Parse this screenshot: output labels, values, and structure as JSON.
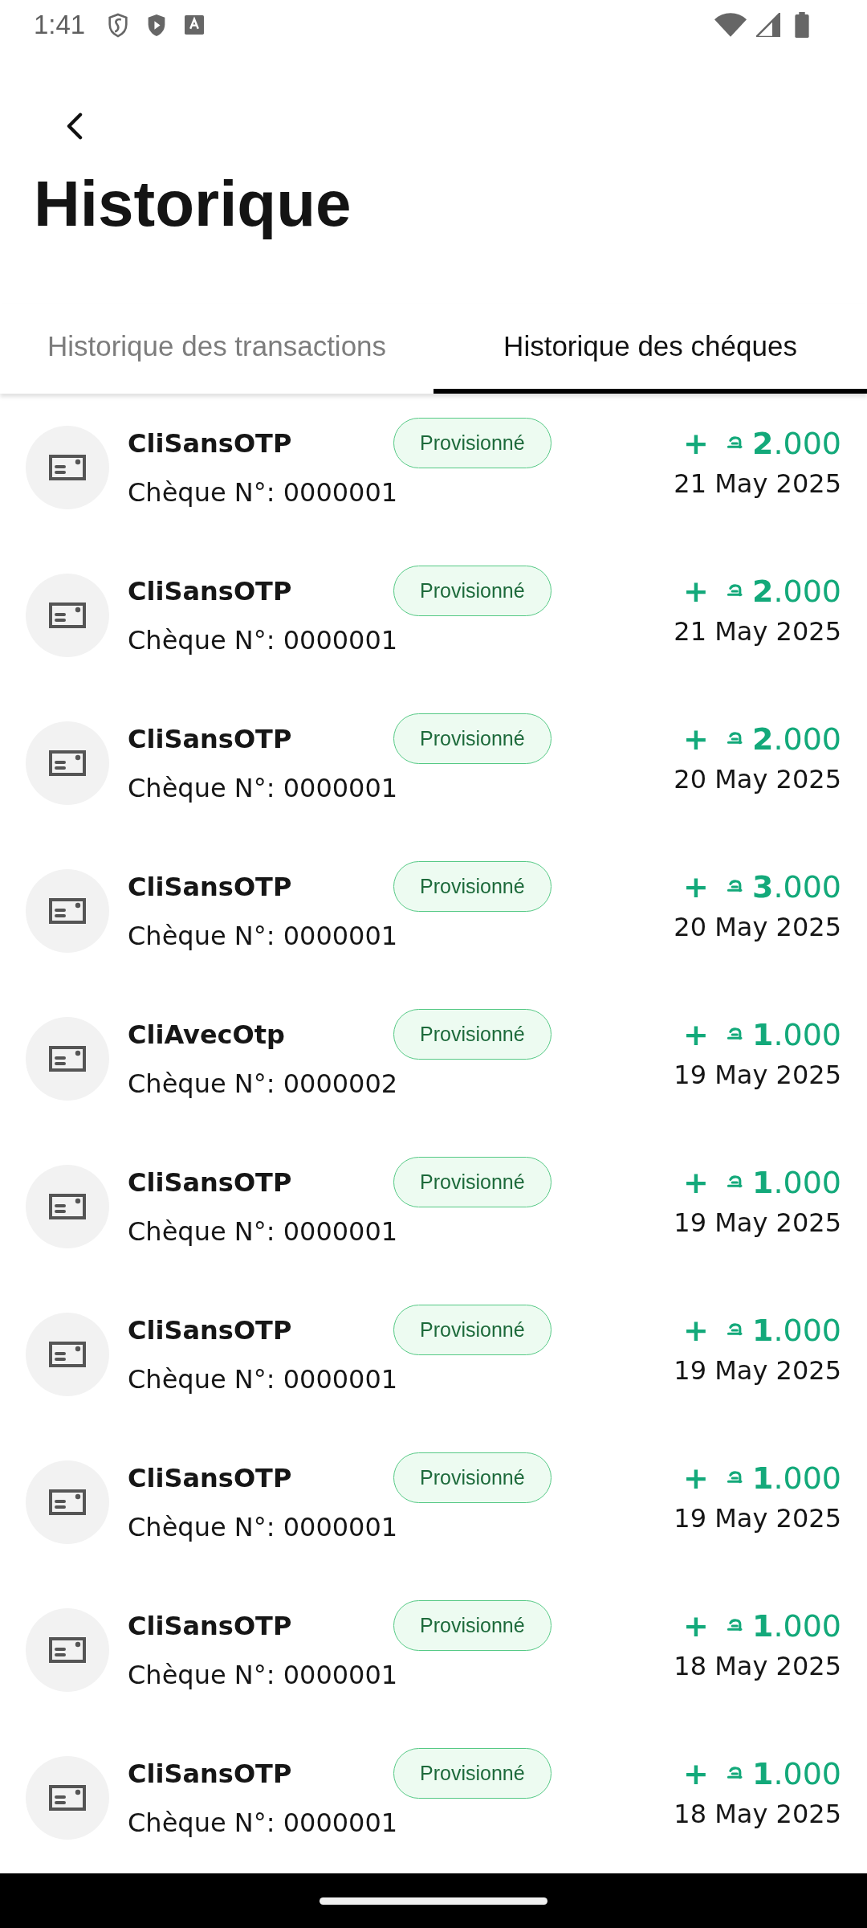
{
  "status_bar": {
    "time": "1:41"
  },
  "header": {
    "title": "Historique"
  },
  "tabs": [
    {
      "label": "Historique des transactions",
      "selected": false
    },
    {
      "label": "Historique des chéques",
      "selected": true
    }
  ],
  "cheques": [
    {
      "name": "CliSansOTP",
      "number": "Chèque N°: 0000001",
      "status": "Provisionné",
      "sign": "+",
      "amount": "**2**.000",
      "date": "21 May 2025"
    },
    {
      "name": "CliSansOTP",
      "number": "Chèque N°: 0000001",
      "status": "Provisionné",
      "sign": "+",
      "amount": "**2**.000",
      "date": "21 May 2025"
    },
    {
      "name": "CliSansOTP",
      "number": "Chèque N°: 0000001",
      "status": "Provisionné",
      "sign": "+",
      "amount": "**2**.000",
      "date": "20 May 2025"
    },
    {
      "name": "CliSansOTP",
      "number": "Chèque N°: 0000001",
      "status": "Provisionné",
      "sign": "+",
      "amount": "**3**.000",
      "date": "20 May 2025"
    },
    {
      "name": "CliAvecOtp",
      "number": "Chèque N°: 0000002",
      "status": "Provisionné",
      "sign": "+",
      "amount": "**1**.000",
      "date": "19 May 2025"
    },
    {
      "name": "CliSansOTP",
      "number": "Chèque N°: 0000001",
      "status": "Provisionné",
      "sign": "+",
      "amount": "**1**.000",
      "date": "19 May 2025"
    },
    {
      "name": "CliSansOTP",
      "number": "Chèque N°: 0000001",
      "status": "Provisionné",
      "sign": "+",
      "amount": "**1**.000",
      "date": "19 May 2025"
    },
    {
      "name": "CliSansOTP",
      "number": "Chèque N°: 0000001",
      "status": "Provisionné",
      "sign": "+",
      "amount": "**1**.000",
      "date": "19 May 2025"
    },
    {
      "name": "CliSansOTP",
      "number": "Chèque N°: 0000001",
      "status": "Provisionné",
      "sign": "+",
      "amount": "**1**.000",
      "date": "18 May 2025"
    },
    {
      "name": "CliSansOTP",
      "number": "Chèque N°: 0000001",
      "status": "Provisionné",
      "sign": "+",
      "amount": "**1**.000",
      "date": "18 May 2025"
    }
  ]
}
